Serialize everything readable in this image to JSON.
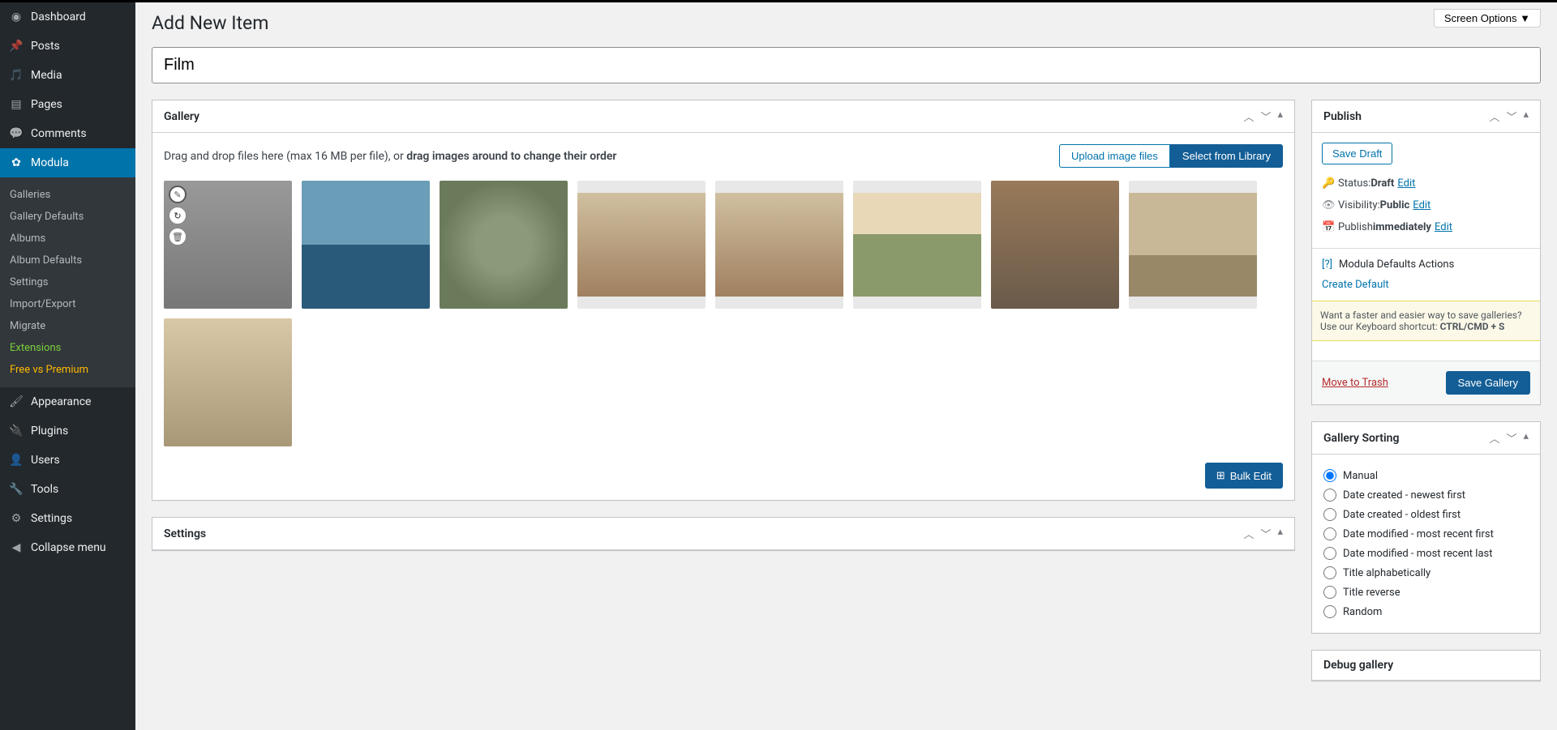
{
  "screen_options": "Screen Options",
  "page_title": "Add New Item",
  "title_value": "Film",
  "sidebar": {
    "items": [
      {
        "label": "Dashboard",
        "icon": "dashboard"
      },
      {
        "label": "Posts",
        "icon": "pin"
      },
      {
        "label": "Media",
        "icon": "media"
      },
      {
        "label": "Pages",
        "icon": "page"
      },
      {
        "label": "Comments",
        "icon": "comment"
      },
      {
        "label": "Modula",
        "icon": "gear",
        "active": true
      },
      {
        "label": "Appearance",
        "icon": "brush"
      },
      {
        "label": "Plugins",
        "icon": "plug"
      },
      {
        "label": "Users",
        "icon": "user"
      },
      {
        "label": "Tools",
        "icon": "wrench"
      },
      {
        "label": "Settings",
        "icon": "sliders"
      },
      {
        "label": "Collapse menu",
        "icon": "collapse"
      }
    ],
    "submenu": [
      {
        "label": "Galleries"
      },
      {
        "label": "Gallery Defaults"
      },
      {
        "label": "Albums"
      },
      {
        "label": "Album Defaults"
      },
      {
        "label": "Settings"
      },
      {
        "label": "Import/Export"
      },
      {
        "label": "Migrate"
      },
      {
        "label": "Extensions",
        "class": "ext"
      },
      {
        "label": "Free vs Premium",
        "class": "fvp"
      }
    ]
  },
  "gallery": {
    "title": "Gallery",
    "hint_prefix": "Drag and drop files here (max 16 MB per file), or ",
    "hint_bold": "drag images around to change their order",
    "upload_btn": "Upload image files",
    "select_btn": "Select from Library",
    "bulk_edit": "Bulk Edit"
  },
  "settings": {
    "title": "Settings"
  },
  "publish": {
    "title": "Publish",
    "save_draft": "Save Draft",
    "status_label": "Status: ",
    "status_value": "Draft",
    "visibility_label": "Visibility: ",
    "visibility_value": "Public",
    "publish_label": "Publish ",
    "publish_value": "immediately",
    "edit": "Edit",
    "defaults_title": "Modula Defaults Actions",
    "create_default": "Create Default",
    "shortcut_note_a": "Want a faster and easier way to save galleries? Use our Keyboard shortcut: ",
    "shortcut_note_b": "CTRL/CMD + S",
    "trash": "Move to Trash",
    "save_gallery": "Save Gallery"
  },
  "sorting": {
    "title": "Gallery Sorting",
    "options": [
      "Manual",
      "Date created - newest first",
      "Date created - oldest first",
      "Date modified - most recent first",
      "Date modified - most recent last",
      "Title alphabetically",
      "Title reverse",
      "Random"
    ],
    "selected": 0
  },
  "debug": {
    "title": "Debug gallery"
  }
}
